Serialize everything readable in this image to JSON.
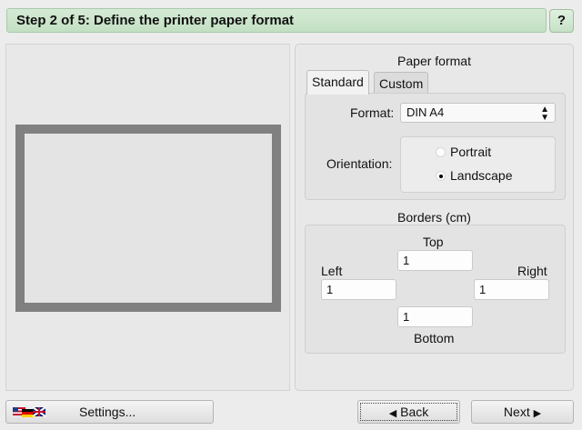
{
  "header": {
    "title": "Step 2 of 5: Define the printer paper format"
  },
  "help_button": {
    "label": "?"
  },
  "paper_format": {
    "title": "Paper format",
    "tabs": [
      {
        "label": "Standard",
        "active": true
      },
      {
        "label": "Custom",
        "active": false
      }
    ],
    "format_label": "Format:",
    "format_value": "DIN A4",
    "orientation_label": "Orientation:",
    "orientation_options": [
      {
        "label": "Portrait",
        "checked": false
      },
      {
        "label": "Landscape",
        "checked": true
      }
    ]
  },
  "borders": {
    "title": "Borders (cm)",
    "top_label": "Top",
    "top_value": "1",
    "left_label": "Left",
    "left_value": "1",
    "right_label": "Right",
    "right_value": "1",
    "bottom_label": "Bottom",
    "bottom_value": "1"
  },
  "footer": {
    "settings_label": "Settings...",
    "back_label": "Back",
    "next_label": "Next"
  }
}
